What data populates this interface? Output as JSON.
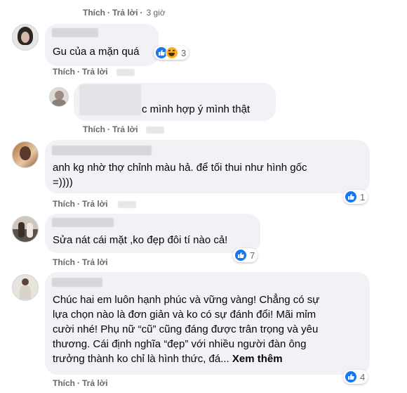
{
  "comments": [
    {
      "actions": {
        "like": "Thích",
        "reply": "Trả lời",
        "time": "3 giờ"
      }
    },
    {
      "text": "Gu của a mặn quá",
      "reactions": {
        "count": "3",
        "icons": [
          "like-icon",
          "haha-icon"
        ]
      },
      "actions": {
        "like": "Thích",
        "reply": "Trả lời"
      }
    },
    {
      "text": "c mình hợp ý mình thật",
      "actions": {
        "like": "Thích",
        "reply": "Trả lời"
      }
    },
    {
      "text_lines": [
        "anh kg nhờ thợ chỉnh màu hả. để tối thui như hình gốc",
        "=))))"
      ],
      "reactions": {
        "count": "1",
        "icons": [
          "like-icon"
        ]
      },
      "actions": {
        "like": "Thích",
        "reply": "Trả lời"
      }
    },
    {
      "text": "Sửa nát cái mặt ,ko đẹp đôi tí nào cả!",
      "reactions": {
        "count": "7",
        "icons": [
          "like-icon"
        ]
      },
      "actions": {
        "like": "Thích",
        "reply": "Trả lời"
      }
    },
    {
      "text_lines": [
        "Chúc hai em luôn hạnh phúc và vững vàng! Chẳng có sự",
        "lựa chọn nào là đơn giản và ko có sự đánh đổi! Mãi mỉm",
        "cười nhé! Phụ nữ “cũ” cũng đáng được trân trọng và yêu",
        "thương. Cái định nghĩa “đẹp” với nhiều người đàn ông",
        "trưởng thành ko chỉ là hình thức, đá..."
      ],
      "see_more": "Xem thêm",
      "reactions": {
        "count": "4",
        "icons": [
          "like-icon"
        ]
      },
      "actions": {
        "like": "Thích",
        "reply": "Trả lời"
      }
    }
  ],
  "colors": {
    "bubble": "#f0f2f5",
    "action_text": "#65676b",
    "like_blue": "#1877f2",
    "text": "#050505"
  }
}
